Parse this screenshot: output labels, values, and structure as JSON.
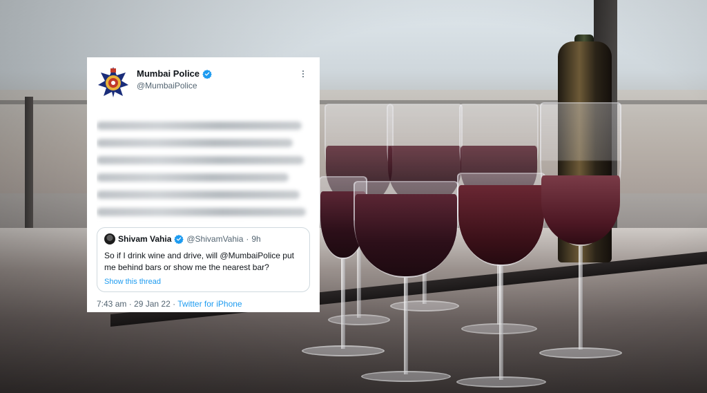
{
  "tweet": {
    "author_name": "Mumbai Police",
    "author_handle": "@MumbaiPolice",
    "verified_icon": "verified-badge-icon",
    "avatar_icon": "mumbai-police-emblem-icon",
    "quote": {
      "author_name": "Shivam Vahia",
      "author_handle": "@ShivamVahia",
      "age": "9h",
      "text": "So if I drink wine and drive, will @MumbaiPolice put me behind bars or show me the nearest bar?",
      "show_thread": "Show this thread"
    },
    "time": "7:43 am",
    "date": "29 Jan 22",
    "source": "Twitter for iPhone"
  },
  "colors": {
    "link_blue": "#1d9bf0",
    "text_primary": "#0f1419",
    "text_secondary": "#536471",
    "wine": "#2c0f19"
  }
}
